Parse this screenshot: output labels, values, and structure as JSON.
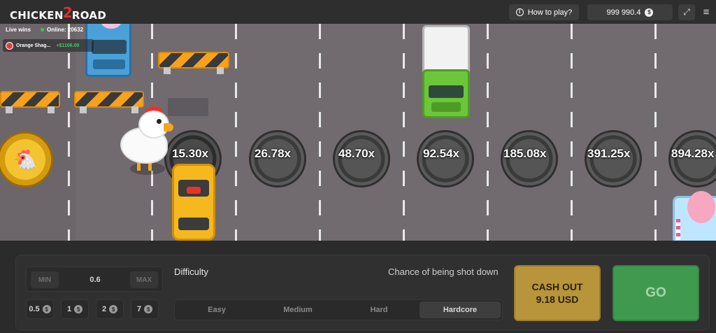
{
  "header": {
    "logo_left": "CHICKEN",
    "logo_mid": "2",
    "logo_right": "ROAD",
    "how_to_play_label": "How to play?",
    "balance": "999 990.4",
    "currency_symbol": "$"
  },
  "live": {
    "title": "Live wins",
    "online_label": "Online: 20632",
    "winner_name": "Orange Shag...",
    "winner_amount": "+$1106.00"
  },
  "multipliers": [
    "15.30x",
    "26.78x",
    "48.70x",
    "92.54x",
    "185.08x",
    "391.25x",
    "894.28x"
  ],
  "bet": {
    "min_label": "MIN",
    "max_label": "MAX",
    "value": "0.6",
    "quick": [
      "0.5",
      "1",
      "2",
      "7"
    ]
  },
  "difficulty": {
    "label": "Difficulty",
    "chance_label": "Chance of being shot down",
    "options": [
      "Easy",
      "Medium",
      "Hard",
      "Hardcore"
    ],
    "selected": "Hardcore"
  },
  "actions": {
    "cashout_line1": "CASH OUT",
    "cashout_line2": "9.18 USD",
    "go_label": "GO"
  },
  "colors": {
    "road": "#716b70",
    "cashout": "#b8953b",
    "go": "#3f9a4f",
    "online_dot": "#3fc35a"
  }
}
